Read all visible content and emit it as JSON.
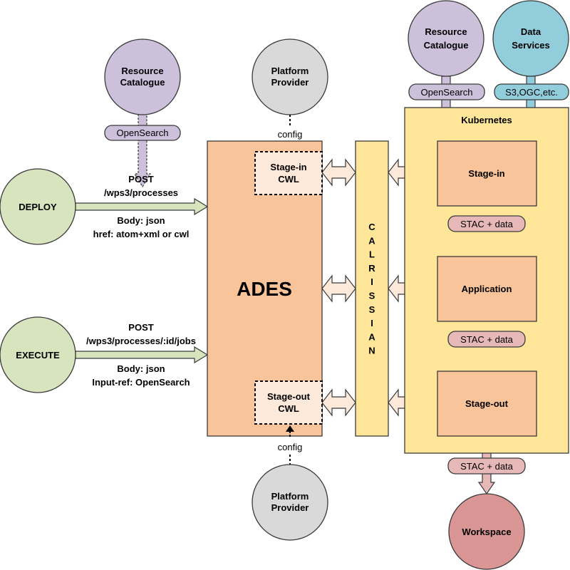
{
  "colors": {
    "resource": "#ccc0da",
    "platform": "#d9d9d9",
    "client": "#d7e4bd",
    "ades": "#f9c499",
    "cwl": "#fde9d9",
    "calrissian": "#ffe699",
    "step": "#f9c499",
    "stac": "#e6b9b8",
    "workspace": "#d99694",
    "data_services": "#92cddc"
  },
  "left_catalogue": {
    "line1": "Resource",
    "line2": "Catalogue",
    "interface": "OpenSearch"
  },
  "platform_top": {
    "line1": "Platform",
    "line2": "Provider",
    "link": "config"
  },
  "platform_bottom": {
    "line1": "Platform",
    "line2": "Provider",
    "link": "config"
  },
  "deploy": {
    "label": "DEPLOY",
    "method": "POST",
    "path": "/wps3/processes",
    "body": "Body: json",
    "extra": "href: atom+xml or cwl"
  },
  "execute": {
    "label": "EXECUTE",
    "method": "POST",
    "path": "/wps3/processes/:id/jobs",
    "body": "Body: json",
    "extra": "Input-ref: OpenSearch"
  },
  "ades": {
    "label": "ADES",
    "stage_in": {
      "line1": "Stage-in",
      "line2": "CWL"
    },
    "stage_out": {
      "line1": "Stage-out",
      "line2": "CWL"
    }
  },
  "calrissian": {
    "letters": [
      "C",
      "A",
      "L",
      "R",
      "I",
      "S",
      "S",
      "I",
      "A",
      "N"
    ]
  },
  "kubernetes": {
    "label": "Kubernetes",
    "steps": [
      "Stage-in",
      "Application",
      "Stage-out"
    ],
    "flows": [
      "STAC + data",
      "STAC + data",
      "STAC + data"
    ]
  },
  "right_catalogue": {
    "line1": "Resource",
    "line2": "Catalogue",
    "interface": "OpenSearch"
  },
  "data_services": {
    "line1": "Data",
    "line2": "Services",
    "interface": "S3,OGC,etc."
  },
  "workspace": {
    "label": "Workspace"
  }
}
